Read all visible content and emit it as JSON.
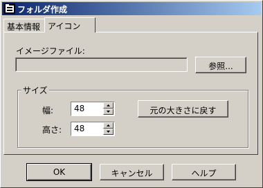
{
  "window": {
    "title": "フォルダ作成"
  },
  "tabs": [
    {
      "label": "基本情報",
      "active": false
    },
    {
      "label": "アイコン",
      "active": true
    }
  ],
  "image_file": {
    "label": "イメージファイル:",
    "value": "",
    "browse_label": "参照..."
  },
  "size_group": {
    "title": "サイズ",
    "width_label": "幅:",
    "width_value": "48",
    "height_label": "高さ:",
    "height_value": "48",
    "reset_label": "元の大きさに戻す"
  },
  "buttons": {
    "ok": "OK",
    "cancel": "キャンセル",
    "help": "ヘルプ"
  }
}
